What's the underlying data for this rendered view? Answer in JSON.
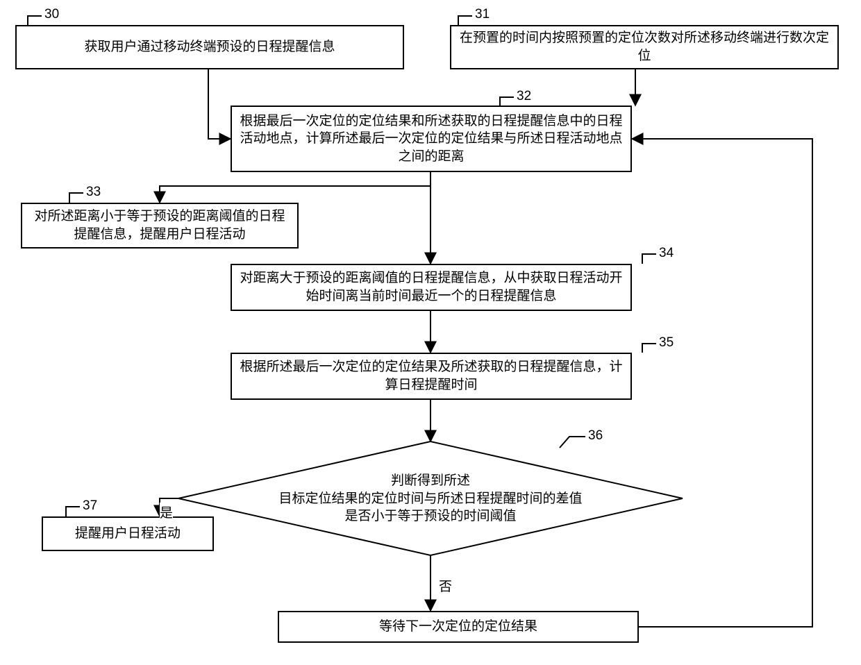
{
  "callouts": {
    "n30": "30",
    "n31": "31",
    "n32": "32",
    "n33": "33",
    "n34": "34",
    "n35": "35",
    "n36": "36",
    "n37": "37"
  },
  "nodes": {
    "n30": "获取用户通过移动终端预设的日程提醒信息",
    "n31": "在预置的时间内按照预置的定位次数对所述移动终端进行数次定位",
    "n32": "根据最后一次定位的定位结果和所述获取的日程提醒信息中的日程活动地点，计算所述最后一次定位的定位结果与所述日程活动地点之间的距离",
    "n33": "对所述距离小于等于预设的距离阈值的日程提醒信息，提醒用户日程活动",
    "n34": "对距离大于预设的距离阈值的日程提醒信息，从中获取日程活动开始时间离当前时间最近一个的日程提醒信息",
    "n35": "根据所述最后一次定位的定位结果及所述获取的日程提醒信息，计算日程提醒时间",
    "n36": "判断得到所述\n目标定位结果的定位时间与所述日程提醒时间的差值\n是否小于等于预设的时间阈值",
    "n37": "提醒用户日程活动",
    "n38": "等待下一次定位的定位结果"
  },
  "edges": {
    "yes": "是",
    "no": "否"
  }
}
